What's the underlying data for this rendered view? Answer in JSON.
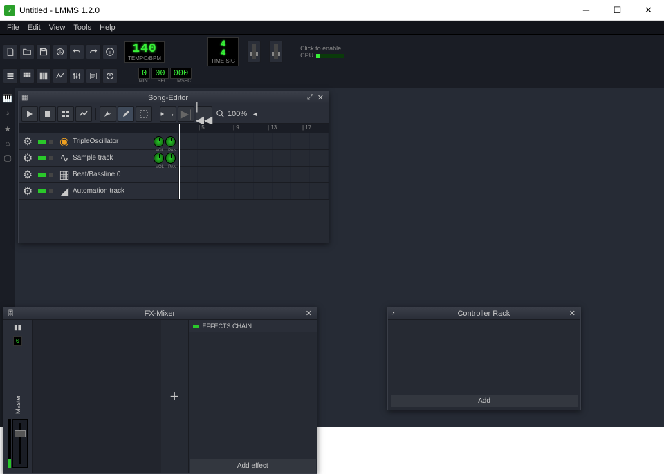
{
  "window": {
    "title": "Untitled - LMMS 1.2.0"
  },
  "menu": [
    "File",
    "Edit",
    "View",
    "Tools",
    "Help"
  ],
  "transport": {
    "tempo_bpm": "140",
    "tempo_label": "TEMPO/BPM",
    "min": "0",
    "sec": "00",
    "msec": "000",
    "min_label": "MIN",
    "sec_label": "SEC",
    "msec_label": "MSEC",
    "timesig_num": "4",
    "timesig_den": "4",
    "timesig_label": "TIME SIG",
    "cpu_label": "Click to enable",
    "cpu_sub": "CPU"
  },
  "song_editor": {
    "title": "Song-Editor",
    "zoom": "100%",
    "ruler": [
      "| 5",
      "| 9",
      "| 13",
      "| 17"
    ],
    "tracks": [
      {
        "name": "TripleOscillator",
        "type": "instrument",
        "vol_pan": true,
        "icon": "osc"
      },
      {
        "name": "Sample track",
        "type": "sample",
        "vol_pan": true,
        "icon": "wave"
      },
      {
        "name": "Beat/Bassline 0",
        "type": "bb",
        "vol_pan": false,
        "icon": "grid"
      },
      {
        "name": "Automation track",
        "type": "automation",
        "vol_pan": false,
        "icon": "env"
      }
    ],
    "vol_label": "VOL",
    "pan_label": "PAN"
  },
  "fx_mixer": {
    "title": "FX-Mixer",
    "master_label": "Master",
    "master_index": "0",
    "chain_title": "EFFECTS CHAIN",
    "add_effect": "Add effect",
    "add_channel": "+"
  },
  "controller_rack": {
    "title": "Controller Rack",
    "add": "Add"
  }
}
